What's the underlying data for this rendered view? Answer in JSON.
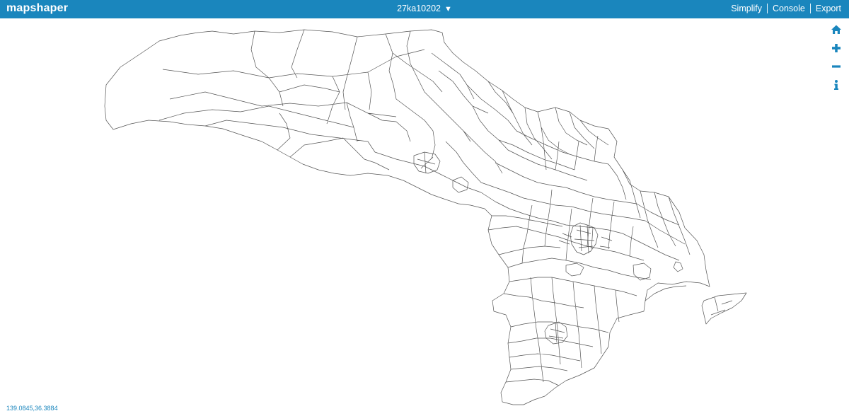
{
  "app": {
    "logo": "mapshaper",
    "layer_name": "27ka10202",
    "layer_caret": "▼"
  },
  "menu": {
    "simplify": "Simplify",
    "console": "Console",
    "export": "Export"
  },
  "tools": [
    "home-icon",
    "zoom-in-icon",
    "zoom-out-icon",
    "info-icon"
  ],
  "status": {
    "coordinates": "139.0845,36.3884"
  },
  "colors": {
    "bar": "#1a86bd",
    "outline": "#555555"
  }
}
